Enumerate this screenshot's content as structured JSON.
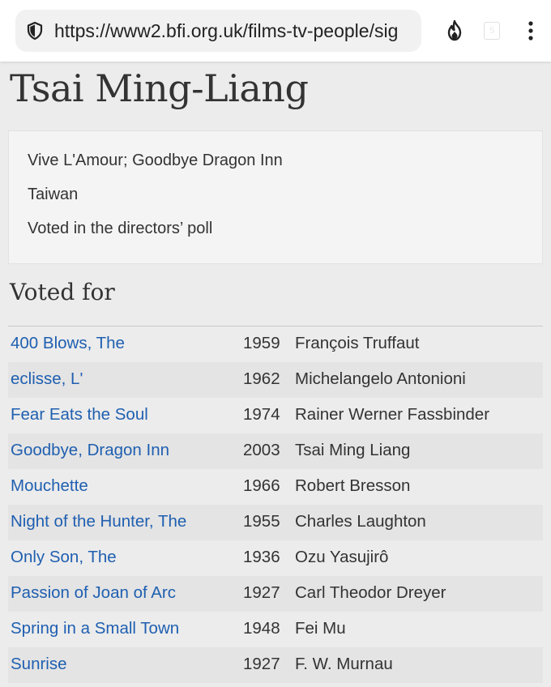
{
  "browser": {
    "url": "https://www2.bfi.org.uk/films-tv-people/sig",
    "tab_count": "5"
  },
  "person": {
    "name": "Tsai Ming-Liang",
    "info": [
      "Vive L'Amour; Goodbye Dragon Inn",
      "Taiwan",
      "Voted in the directors’ poll"
    ]
  },
  "votes": {
    "heading": "Voted for",
    "rows": [
      {
        "title": "400 Blows, The",
        "year": "1959",
        "director": "François Truffaut"
      },
      {
        "title": "eclisse, L'",
        "year": "1962",
        "director": "Michelangelo Antonioni"
      },
      {
        "title": "Fear Eats the Soul",
        "year": "1974",
        "director": "Rainer Werner Fassbinder"
      },
      {
        "title": "Goodbye, Dragon Inn",
        "year": "2003",
        "director": "Tsai Ming Liang"
      },
      {
        "title": "Mouchette",
        "year": "1966",
        "director": "Robert Bresson"
      },
      {
        "title": "Night of the Hunter, The",
        "year": "1955",
        "director": "Charles Laughton"
      },
      {
        "title": "Only Son, The",
        "year": "1936",
        "director": "Ozu Yasujirô"
      },
      {
        "title": "Passion of Joan of Arc",
        "year": "1927",
        "director": "Carl Theodor Dreyer"
      },
      {
        "title": "Spring in a Small Town",
        "year": "1948",
        "director": "Fei Mu"
      },
      {
        "title": "Sunrise",
        "year": "1927",
        "director": "F. W. Murnau"
      }
    ]
  },
  "colors": {
    "link": "#1f5fb0",
    "text": "#333333",
    "page_bg": "#ececec"
  },
  "icons": [
    "shield-icon",
    "flame-icon",
    "tab-switcher-icon",
    "more-vert-icon"
  ]
}
